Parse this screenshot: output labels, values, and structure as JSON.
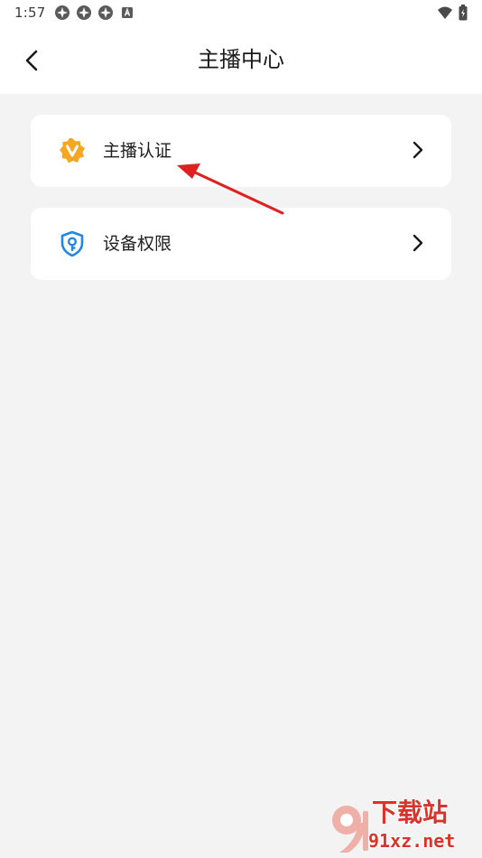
{
  "status_bar": {
    "time": "1:57",
    "left_icons": [
      "notification-icon",
      "notification-icon",
      "notification-icon",
      "app-icon"
    ],
    "right_icons": [
      "wifi-icon",
      "battery-icon"
    ]
  },
  "header": {
    "title": "主播中心",
    "back_icon": "chevron-left-icon"
  },
  "menu": {
    "items": [
      {
        "label": "主播认证",
        "icon": "verified-badge-icon",
        "icon_color": "#f5a623"
      },
      {
        "label": "设备权限",
        "icon": "shield-key-icon",
        "icon_color": "#1e88e5"
      }
    ]
  },
  "annotation": {
    "arrow_color": "#e02020"
  },
  "watermark": {
    "site": "下载站",
    "domain": "91xz.net"
  },
  "colors": {
    "background": "#f3f3f3",
    "surface": "#ffffff",
    "text": "#1e1e1e"
  }
}
